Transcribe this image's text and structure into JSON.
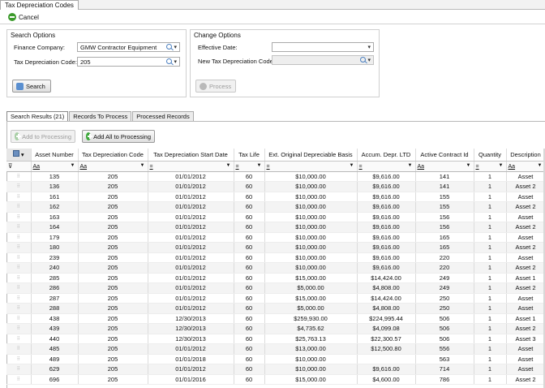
{
  "doc_tab": {
    "label": "Tax Depreciation Codes"
  },
  "toolbar": {
    "cancel_label": "Cancel"
  },
  "search_options": {
    "title": "Search Options",
    "finance_company_label": "Finance Company:",
    "finance_company_value": "GMW Contractor Equipment",
    "tax_code_label": "Tax Depreciation Code:",
    "tax_code_value": "205",
    "search_button": "Search"
  },
  "change_options": {
    "title": "Change Options",
    "effective_date_label": "Effective Date:",
    "effective_date_value": "",
    "new_code_label": "New Tax Depreciation Code:",
    "new_code_value": "",
    "process_button": "Process"
  },
  "result_tabs": [
    {
      "label": "Search Results (21)",
      "active": true
    },
    {
      "label": "Records To Process",
      "active": false
    },
    {
      "label": "Processed Records",
      "active": false
    }
  ],
  "buttons": {
    "add_to_processing": "Add to Processing",
    "add_all": "Add All to Processing"
  },
  "grid": {
    "columns": [
      "",
      "Asset Number",
      "Tax Depreciation Code",
      "Tax Depreciation Start Date",
      "Tax Life",
      "Ext. Original Depreciable Basis",
      "Accum. Depr. LTD",
      "Active Contract Id",
      "Quantity",
      "Description"
    ],
    "filters": [
      "",
      "Aa",
      "Aa",
      "=",
      "=",
      "=",
      "=",
      "Aa",
      "=",
      "Aa"
    ],
    "rows": [
      [
        "135",
        "205",
        "01/01/2012",
        "60",
        "$10,000.00",
        "$9,616.00",
        "141",
        "1",
        "Asset"
      ],
      [
        "136",
        "205",
        "01/01/2012",
        "60",
        "$10,000.00",
        "$9,616.00",
        "141",
        "1",
        "Asset 2"
      ],
      [
        "161",
        "205",
        "01/01/2012",
        "60",
        "$10,000.00",
        "$9,616.00",
        "155",
        "1",
        "Asset"
      ],
      [
        "162",
        "205",
        "01/01/2012",
        "60",
        "$10,000.00",
        "$9,616.00",
        "155",
        "1",
        "Asset 2"
      ],
      [
        "163",
        "205",
        "01/01/2012",
        "60",
        "$10,000.00",
        "$9,616.00",
        "156",
        "1",
        "Asset"
      ],
      [
        "164",
        "205",
        "01/01/2012",
        "60",
        "$10,000.00",
        "$9,616.00",
        "156",
        "1",
        "Asset 2"
      ],
      [
        "179",
        "205",
        "01/01/2012",
        "60",
        "$10,000.00",
        "$9,616.00",
        "165",
        "1",
        "Asset"
      ],
      [
        "180",
        "205",
        "01/01/2012",
        "60",
        "$10,000.00",
        "$9,616.00",
        "165",
        "1",
        "Asset 2"
      ],
      [
        "239",
        "205",
        "01/01/2012",
        "60",
        "$10,000.00",
        "$9,616.00",
        "220",
        "1",
        "Asset"
      ],
      [
        "240",
        "205",
        "01/01/2012",
        "60",
        "$10,000.00",
        "$9,616.00",
        "220",
        "1",
        "Asset 2"
      ],
      [
        "285",
        "205",
        "01/01/2012",
        "60",
        "$15,000.00",
        "$14,424.00",
        "249",
        "1",
        "Asset 1"
      ],
      [
        "286",
        "205",
        "01/01/2012",
        "60",
        "$5,000.00",
        "$4,808.00",
        "249",
        "1",
        "Asset 2"
      ],
      [
        "287",
        "205",
        "01/01/2012",
        "60",
        "$15,000.00",
        "$14,424.00",
        "250",
        "1",
        "Asset"
      ],
      [
        "288",
        "205",
        "01/01/2012",
        "60",
        "$5,000.00",
        "$4,808.00",
        "250",
        "1",
        "Asset"
      ],
      [
        "438",
        "205",
        "12/30/2013",
        "60",
        "$259,930.00",
        "$224,995.44",
        "506",
        "1",
        "Asset 1"
      ],
      [
        "439",
        "205",
        "12/30/2013",
        "60",
        "$4,735.62",
        "$4,099.08",
        "506",
        "1",
        "Asset 2"
      ],
      [
        "440",
        "205",
        "12/30/2013",
        "60",
        "$25,763.13",
        "$22,300.57",
        "506",
        "1",
        "Asset 3"
      ],
      [
        "485",
        "205",
        "01/01/2012",
        "60",
        "$13,000.00",
        "$12,500.80",
        "556",
        "1",
        "Asset"
      ],
      [
        "489",
        "205",
        "01/01/2018",
        "60",
        "$10,000.00",
        "",
        "563",
        "1",
        "Asset"
      ],
      [
        "629",
        "205",
        "01/01/2012",
        "60",
        "$10,000.00",
        "$9,616.00",
        "714",
        "1",
        "Asset"
      ],
      [
        "696",
        "205",
        "01/01/2016",
        "60",
        "$15,000.00",
        "$4,600.00",
        "786",
        "1",
        "Asset 2"
      ]
    ]
  }
}
